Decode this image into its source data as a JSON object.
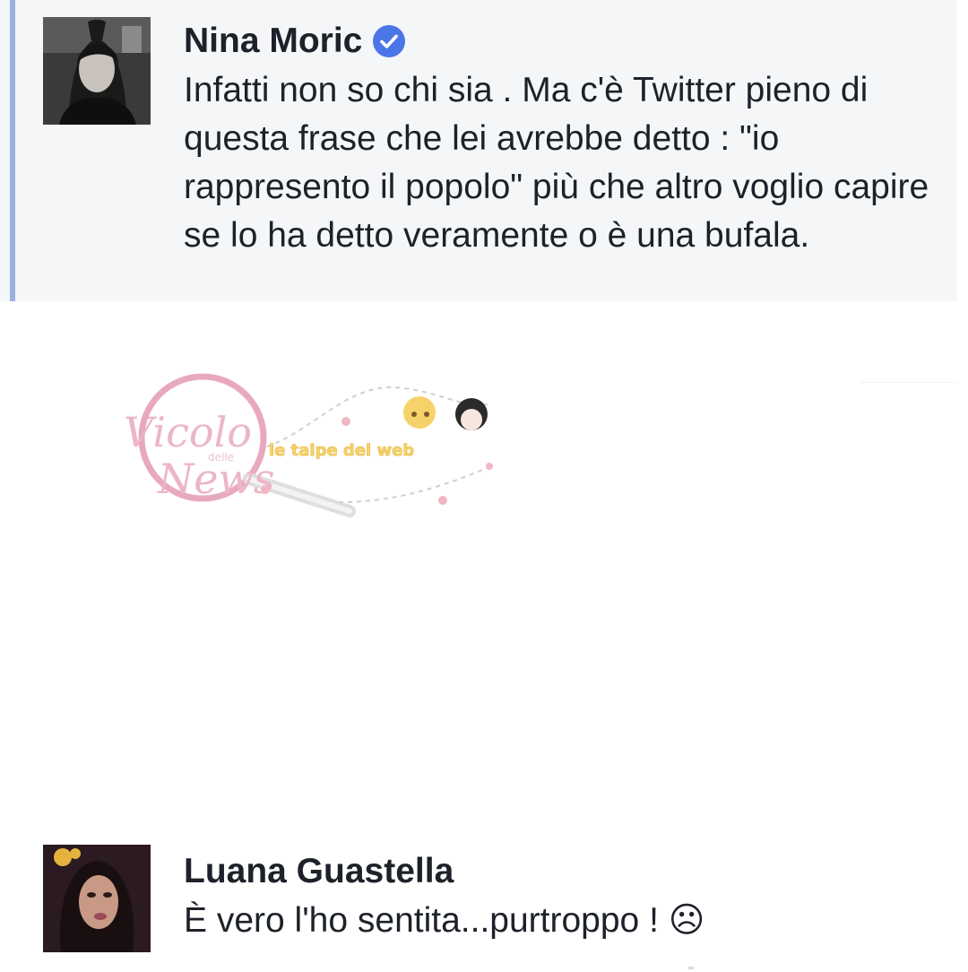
{
  "comments": [
    {
      "author": "Nina Moric",
      "verified": true,
      "text": "Infatti non so chi sia . Ma c'è Twitter pieno di questa frase che lei avrebbe detto : \"io rappresento il popolo\" più che altro voglio capire se lo ha detto veramente o è una bufala."
    },
    {
      "author": "Luana Guastella",
      "verified": false,
      "text": "È vero l'ho sentita...purtroppo ! ☹"
    }
  ],
  "watermark": {
    "brand_script": "Vicolo",
    "brand_small": "delle",
    "brand_script_2": "News",
    "tagline": "le talpe del web"
  },
  "colors": {
    "highlight_bg": "#f5f6f8",
    "accent_bar": "#9ab0e0",
    "verified_badge": "#4a76e8",
    "text": "#1d2129",
    "watermark_pink": "#e8a9be",
    "watermark_yellow": "#f5d36a"
  }
}
